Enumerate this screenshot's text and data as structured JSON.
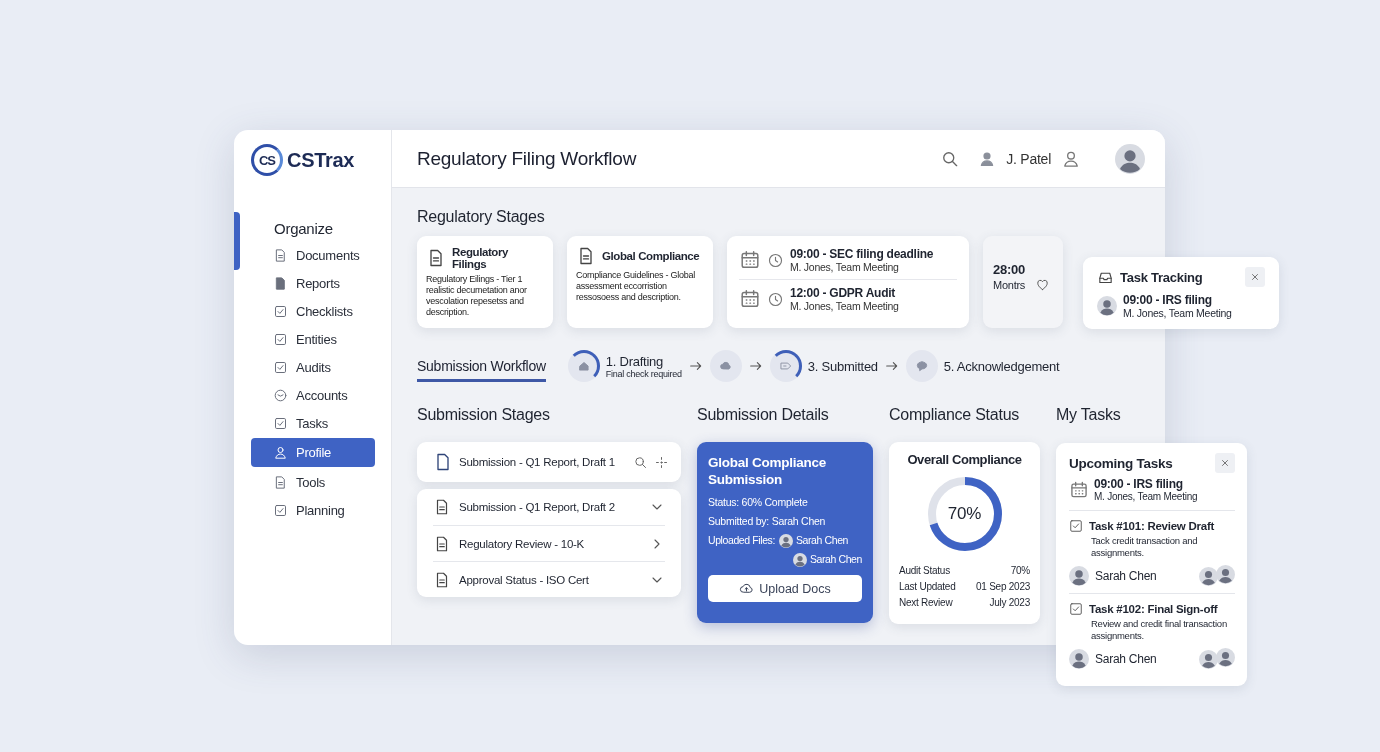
{
  "sidebar": {
    "logo": {
      "mark": "CS",
      "name": "CSTrax"
    },
    "section": "Organize",
    "items": [
      {
        "label": "Documents",
        "selected": false
      },
      {
        "label": "Reports",
        "selected": false
      },
      {
        "label": "Checklists",
        "selected": false
      },
      {
        "label": "Entities",
        "selected": false
      },
      {
        "label": "Audits",
        "selected": false
      },
      {
        "label": "Accounts",
        "selected": false
      },
      {
        "label": "Tasks",
        "selected": false
      },
      {
        "label": "Profile",
        "selected": true
      },
      {
        "label": "Tools",
        "selected": false
      },
      {
        "label": "Planning",
        "selected": false
      }
    ]
  },
  "header": {
    "title": "Regulatory Filing Workflow",
    "user": "J. Patel"
  },
  "regulatory_stages": {
    "heading": "Regulatory Stages",
    "cards": [
      {
        "kind": "document",
        "title": "Regulatory Filings",
        "text": "Regulatory Eilings - Tier 1 realistic decumetation anor vescolation repesetss and description."
      },
      {
        "kind": "document",
        "title": "Global Compliance",
        "text": "Compliance Guidelines - Global assessment eccorristion ressosoess and description."
      },
      {
        "kind": "schedule",
        "events": [
          {
            "title": "09:00 - SEC filing deadline",
            "detail": "M. Jones, Team Meeting"
          },
          {
            "title": "12:00 - GDPR Audit",
            "detail": "M. Jones, Team Meeting"
          }
        ]
      },
      {
        "kind": "timer",
        "time": "28:00",
        "unit": "Montrs"
      }
    ]
  },
  "task_tracking": {
    "title": "Task Tracking",
    "event": {
      "title": "09:00 - IRS filing",
      "detail": "M. Jones, Team Meeting"
    }
  },
  "workflow": {
    "tab": {
      "label": "Submission Workflow",
      "selected": true
    },
    "steps": [
      {
        "kind": "home",
        "label": "1. Drafting",
        "note": "Final check required",
        "active": true
      },
      {
        "kind": "cloud",
        "active": false
      },
      {
        "kind": "tag",
        "label": "3. Submitted",
        "active": true
      },
      {
        "kind": "chat",
        "label": "5. Acknowledgement",
        "active": false
      }
    ]
  },
  "submission_stages": {
    "heading": "Submission Stages",
    "pinned": {
      "label": "Submission - Q1 Report, Draft 1"
    },
    "rows": [
      {
        "label": "Submission - Q1 Report, Draft 2",
        "expanded": true
      },
      {
        "label": "Regulatory Review - 10-K",
        "expanded": false
      },
      {
        "label": "Approval Status - ISO Cert",
        "expanded": true
      }
    ]
  },
  "submission_details": {
    "heading": "Submission Details",
    "title": "Global Compliance Submission",
    "status": "Status: 60% Complete",
    "submitted_label": "Submitted by:",
    "submitted_by": "Sarah Chen",
    "files_label": "Uploaded Files:",
    "files": [
      "Sarah Chen",
      "Sarah Chen"
    ],
    "button": "Upload Docs"
  },
  "compliance_status": {
    "heading": "Compliance Status",
    "title": "Overall Compliance",
    "level": 0.7,
    "reading": "70%",
    "stats": [
      {
        "label": "Audit Status",
        "value": "70%"
      },
      {
        "label": "Last Updated",
        "value": "01 Sep 2023"
      },
      {
        "label": "Next Review",
        "value": "July 2023"
      }
    ]
  },
  "my_tasks": {
    "heading": "My Tasks",
    "panel": {
      "title": "Upcoming Tasks",
      "event": {
        "title": "09:00 - IRS filing",
        "detail": "M. Jones, Team Meeting"
      },
      "tasks": [
        {
          "title": "Task #101: Review Draft",
          "text": "Tack credit transaction and assignments.",
          "assignee": "Sarah Chen",
          "checked": true
        },
        {
          "title": "Task #102: Final Sign-off",
          "text": "Review and credit final transaction assignments.",
          "assignee": "Sarah Chen",
          "checked": true
        }
      ]
    }
  }
}
